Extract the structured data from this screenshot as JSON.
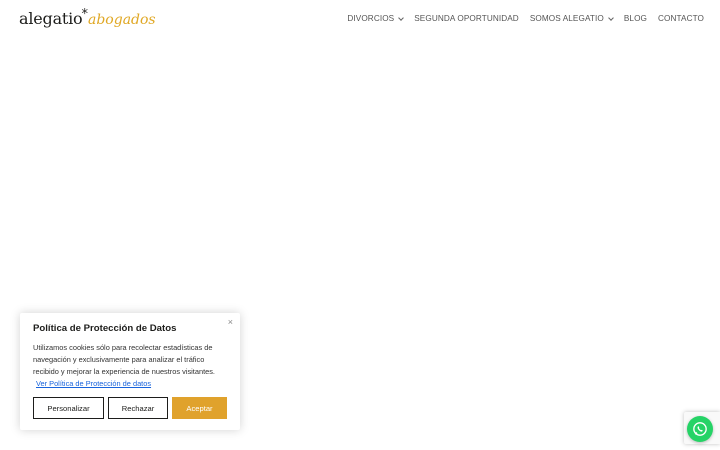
{
  "brand": {
    "logo_main": "alegatio",
    "logo_star": "*",
    "logo_sub": "abogados",
    "accent_color": "#e0a825"
  },
  "nav": {
    "items": [
      {
        "label": "DIVORCIOS",
        "has_dropdown": true
      },
      {
        "label": "SEGUNDA OPORTUNIDAD",
        "has_dropdown": false
      },
      {
        "label": "SOMOS ALEGATIO",
        "has_dropdown": true
      },
      {
        "label": "BLOG",
        "has_dropdown": false
      },
      {
        "label": "CONTACTO",
        "has_dropdown": false
      }
    ]
  },
  "cookie_banner": {
    "close_label": "×",
    "title": "Política de Protección de Datos",
    "text": "Utilizamos cookies sólo para recolectar estadísticas de navegación y exclusivamente para analizar el tráfico recibido y mejorar la experiencia de nuestros visitantes.",
    "link_text": "Ver Política de Protección de datos",
    "buttons": {
      "personalizar": "Personalizar",
      "rechazar": "Rechazar",
      "aceptar": "Aceptar"
    },
    "accept_color": "#e0a22c",
    "link_color": "#1863dc"
  },
  "widgets": {
    "whatsapp_icon": "whatsapp-icon",
    "whatsapp_color": "#25d366",
    "recaptcha_icon": "recaptcha-badge"
  }
}
